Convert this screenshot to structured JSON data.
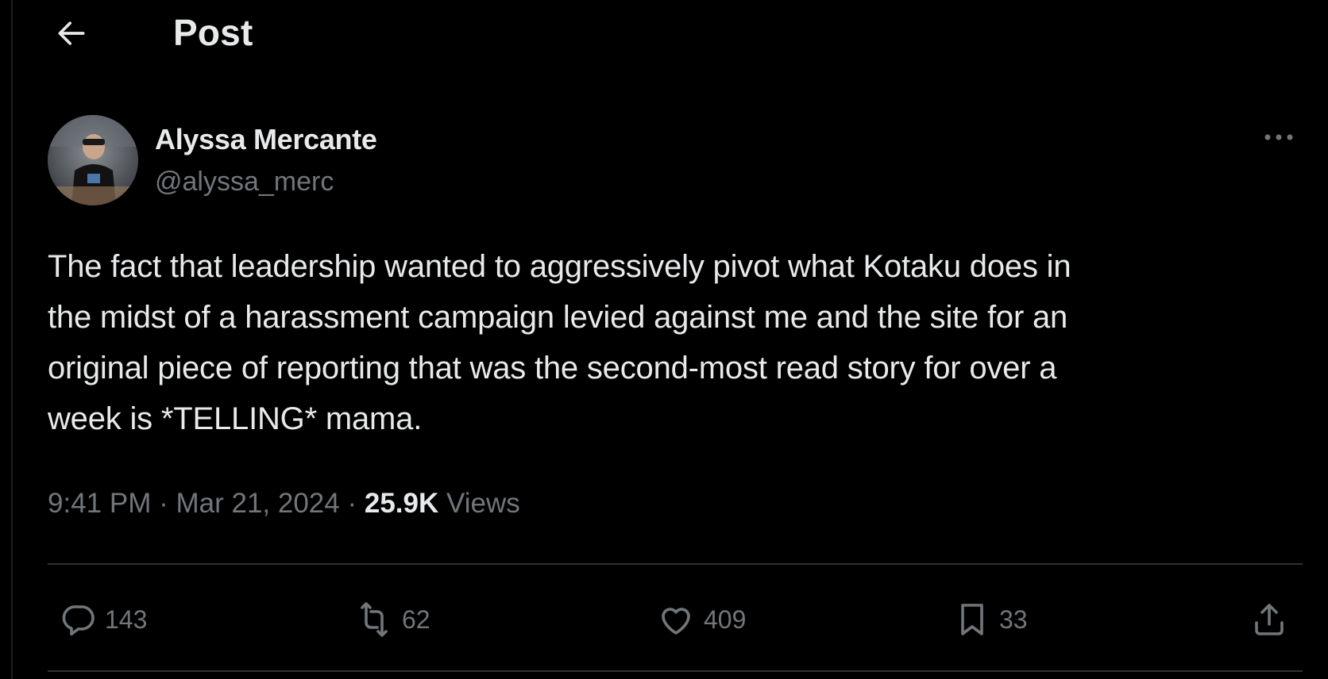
{
  "header": {
    "title": "Post",
    "back_icon": "arrow-left-icon"
  },
  "post": {
    "author": {
      "name": "Alyssa Mercante",
      "handle": "@alyssa_merc"
    },
    "text": "The fact that leadership wanted to aggressively pivot what Kotaku does in\nthe midst of a harassment campaign levied against me and the site for an\noriginal piece of reporting that was the second-most read story for over a\nweek is *TELLING* mama.",
    "time": "9:41 PM",
    "separator": "·",
    "date": "Mar 21, 2024",
    "views_count": "25.9K",
    "views_label": "Views"
  },
  "actions": {
    "replies": "143",
    "reposts": "62",
    "likes": "409",
    "bookmarks": "33"
  },
  "colors": {
    "background": "#000000",
    "text_primary": "#e7e9ea",
    "text_secondary": "#71767b",
    "divider": "#2f3336"
  }
}
